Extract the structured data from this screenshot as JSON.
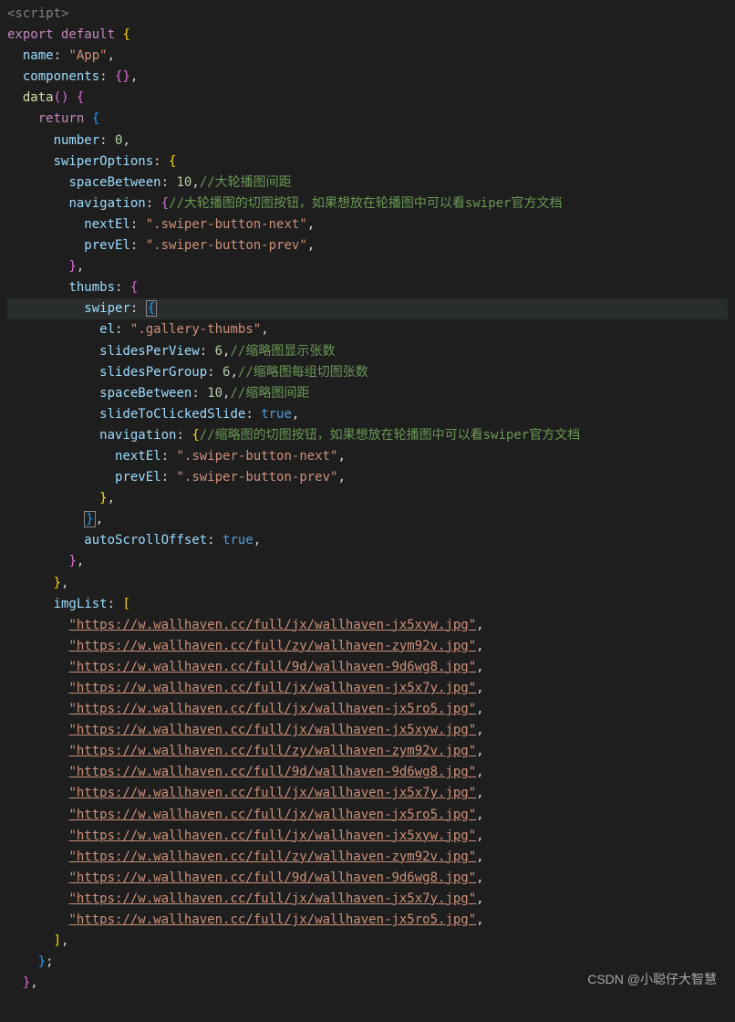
{
  "code": {
    "tag_open": "<script>",
    "export_default": "export default",
    "lbrace": "{",
    "rbrace": "}",
    "lbracket": "[",
    "rbracket": "]",
    "lparen": "(",
    "rparen": ")",
    "comma": ",",
    "colon": ":",
    "semicolon": ";",
    "name_key": "name",
    "name_val": "\"App\"",
    "components_key": "components",
    "data_key": "data",
    "return_kw": "return",
    "number_key": "number",
    "number_val": "0",
    "swiperOptions_key": "swiperOptions",
    "spaceBetween_key": "spaceBetween",
    "spaceBetween_val": "10",
    "comment_big_gap": "//大轮播图间距",
    "navigation_key": "navigation",
    "comment_big_nav": "//大轮播图的切图按钮，如果想放在轮播图中可以看swiper官方文档",
    "nextEl_key": "nextEl",
    "nextEl_val": "\".swiper-button-next\"",
    "prevEl_key": "prevEl",
    "prevEl_val": "\".swiper-button-prev\"",
    "thumbs_key": "thumbs",
    "swiper_key": "swiper",
    "el_key": "el",
    "el_val": "\".gallery-thumbs\"",
    "slidesPerView_key": "slidesPerView",
    "slidesPerView_val": "6",
    "comment_thumb_count": "//缩略图显示张数",
    "slidesPerGroup_key": "slidesPerGroup",
    "slidesPerGroup_val": "6",
    "comment_thumb_group": "//缩略图每组切图张数",
    "spaceBetween_thumb_val": "10",
    "comment_thumb_gap": "//缩略图间距",
    "slideToClickedSlide_key": "slideToClickedSlide",
    "true_val": "true",
    "comment_thumb_nav": "//缩略图的切图按钮，如果想放在轮播图中可以看swiper官方文档",
    "autoScrollOffset_key": "autoScrollOffset",
    "imgList_key": "imgList",
    "urls": [
      "\"https://w.wallhaven.cc/full/jx/wallhaven-jx5xyw.jpg\"",
      "\"https://w.wallhaven.cc/full/zy/wallhaven-zym92v.jpg\"",
      "\"https://w.wallhaven.cc/full/9d/wallhaven-9d6wg8.jpg\"",
      "\"https://w.wallhaven.cc/full/jx/wallhaven-jx5x7y.jpg\"",
      "\"https://w.wallhaven.cc/full/jx/wallhaven-jx5ro5.jpg\"",
      "\"https://w.wallhaven.cc/full/jx/wallhaven-jx5xyw.jpg\"",
      "\"https://w.wallhaven.cc/full/zy/wallhaven-zym92v.jpg\"",
      "\"https://w.wallhaven.cc/full/9d/wallhaven-9d6wg8.jpg\"",
      "\"https://w.wallhaven.cc/full/jx/wallhaven-jx5x7y.jpg\"",
      "\"https://w.wallhaven.cc/full/jx/wallhaven-jx5ro5.jpg\"",
      "\"https://w.wallhaven.cc/full/jx/wallhaven-jx5xyw.jpg\"",
      "\"https://w.wallhaven.cc/full/zy/wallhaven-zym92v.jpg\"",
      "\"https://w.wallhaven.cc/full/9d/wallhaven-9d6wg8.jpg\"",
      "\"https://w.wallhaven.cc/full/jx/wallhaven-jx5x7y.jpg\"",
      "\"https://w.wallhaven.cc/full/jx/wallhaven-jx5ro5.jpg\""
    ]
  },
  "watermark": "CSDN @小聪仔大智慧"
}
